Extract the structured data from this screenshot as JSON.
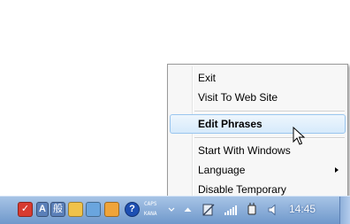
{
  "menu": {
    "items": [
      {
        "label": "Exit"
      },
      {
        "label": "Visit To Web Site"
      },
      {
        "label": "Edit Phrases"
      },
      {
        "label": "Start With Windows"
      },
      {
        "label": "Language",
        "submenu": true
      },
      {
        "label": "Disable Temporary"
      }
    ]
  },
  "taskbar": {
    "ime_text": "A",
    "ime_mode": "般",
    "help_glyph": "?",
    "caps_label": "CAPS",
    "kana_label": "KANA",
    "clock": "14:45"
  },
  "colors": {
    "menu_bg": "#f7f7f7",
    "highlight": "#d6eafb",
    "taskbar": "#7fa3d2"
  }
}
